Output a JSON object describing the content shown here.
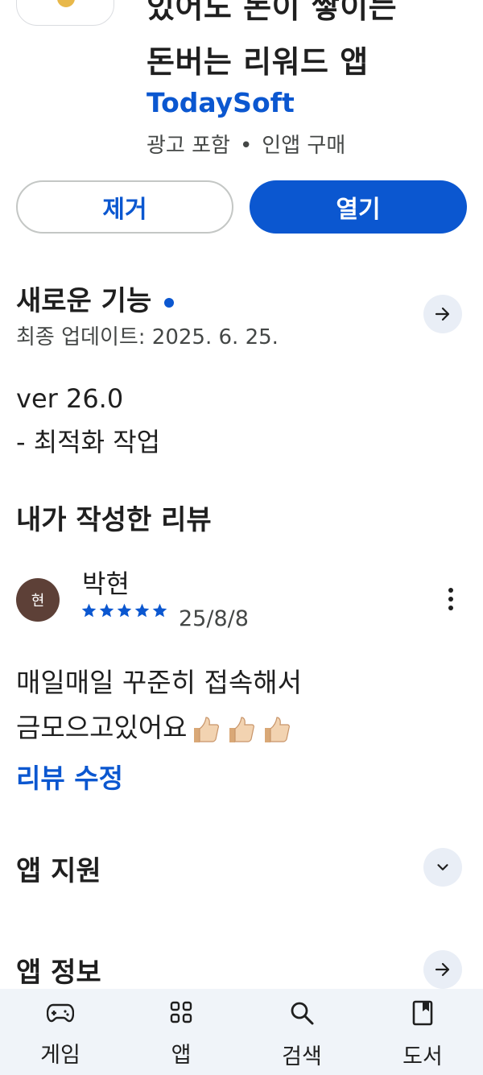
{
  "app": {
    "title_line1": "있어도 돈이 쌓이는",
    "title_line2": "돈버는 리워드 앱",
    "developer": "TodaySoft",
    "meta_ads": "광고 포함",
    "meta_separator": "•",
    "meta_iap": "인앱 구매"
  },
  "actions": {
    "remove_label": "제거",
    "open_label": "열기"
  },
  "whats_new": {
    "title": "새로운 기능",
    "updated": "최종 업데이트: 2025. 6. 25.",
    "version_line": "ver 26.0",
    "note_line": "- 최적화 작업"
  },
  "my_review": {
    "title": "내가 작성한 리뷰",
    "avatar_text": "현",
    "reviewer_name": "박현",
    "rating": 5,
    "date": "25/8/8",
    "text_line1": "매일매일 꾸준히 접속해서",
    "text_line2": "금모으고있어요",
    "emoji": "thumbs-up-icon ×3",
    "edit_label": "리뷰 수정"
  },
  "app_support": {
    "title": "앱 지원"
  },
  "app_info": {
    "title": "앱 정보"
  },
  "nav": {
    "games": "게임",
    "apps": "앱",
    "search": "검색",
    "books": "도서"
  },
  "colors": {
    "accent": "#0b57d0",
    "icon_button_bg": "#e9eef6",
    "nav_bg": "#f0f4f9",
    "avatar_bg": "#5d4037"
  }
}
